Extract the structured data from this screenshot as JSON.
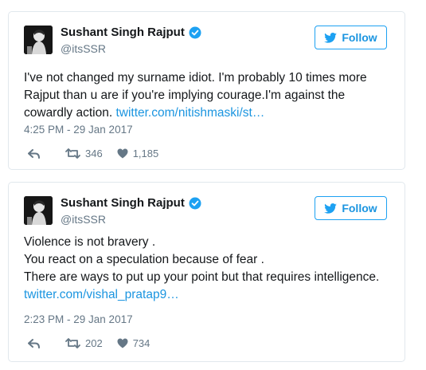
{
  "tweets": [
    {
      "name": "Sushant Singh Rajput",
      "handle": "@itsSSR",
      "follow_label": "Follow",
      "text": "I've not changed my surname idiot. I'm probably 10 times more Rajput than u are if you're implying courage.I'm against the cowardly action. ",
      "link": "twitter.com/nitishmaski/st…",
      "timestamp": "4:25 PM - 29 Jan 2017",
      "retweets": "346",
      "likes": "1,185"
    },
    {
      "name": "Sushant Singh Rajput",
      "handle": "@itsSSR",
      "follow_label": "Follow",
      "text": "Violence is not bravery .\nYou react on a speculation because of fear .\nThere are ways to put up your point but that requires intelligence. ",
      "link": "twitter.com/vishal_pratap9…",
      "timestamp": "2:23 PM - 29 Jan 2017",
      "retweets": "202",
      "likes": "734"
    }
  ],
  "colors": {
    "accent": "#1da1f2",
    "link": "#1b95e0",
    "muted": "#657786",
    "border": "#e1e8ed"
  },
  "icons": [
    "avatar",
    "verified-badge-icon",
    "twitter-bird-icon",
    "reply-icon",
    "retweet-icon",
    "heart-icon"
  ]
}
